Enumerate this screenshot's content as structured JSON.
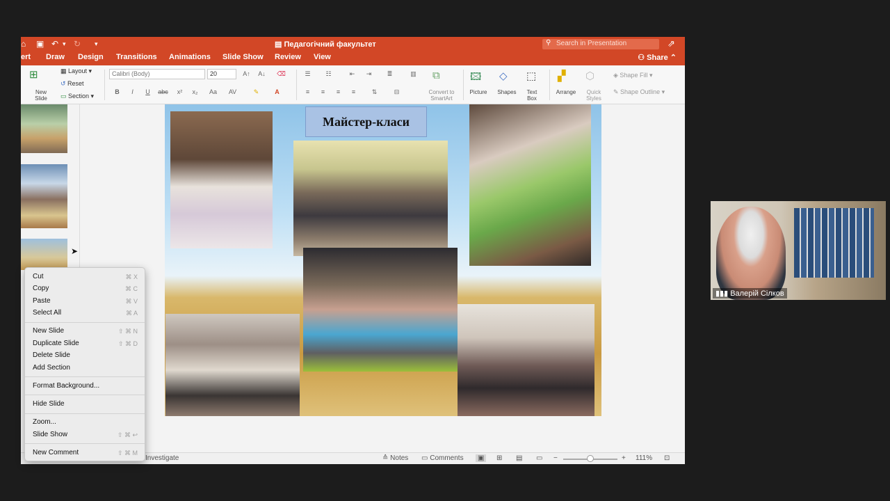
{
  "window": {
    "title": "Педагогічний факультет",
    "search_placeholder": "Search in Presentation",
    "share_label": "Share"
  },
  "tabs": [
    "ert",
    "Draw",
    "Design",
    "Transitions",
    "Animations",
    "Slide Show",
    "Review",
    "View"
  ],
  "ribbon": {
    "new_slide": "New Slide",
    "layout": "Layout",
    "reset": "Reset",
    "section": "Section",
    "font_name": "Calibri (Body)",
    "font_size": "20",
    "convert_smartart": "Convert to SmartArt",
    "picture": "Picture",
    "shapes": "Shapes",
    "text_box": "Text Box",
    "arrange": "Arrange",
    "quick_styles": "Quick Styles",
    "shape_fill": "Shape Fill",
    "shape_outline": "Shape Outline"
  },
  "slide": {
    "title": "Майстер-класи"
  },
  "context_menu": {
    "items": [
      {
        "label": "Cut",
        "shortcut": "⌘ X"
      },
      {
        "label": "Copy",
        "shortcut": "⌘ C"
      },
      {
        "label": "Paste",
        "shortcut": "⌘ V"
      },
      {
        "label": "Select All",
        "shortcut": "⌘ A"
      },
      {
        "label": "New Slide",
        "shortcut": "⇧ ⌘ N"
      },
      {
        "label": "Duplicate Slide",
        "shortcut": "⇧ ⌘ D"
      },
      {
        "label": "Delete Slide",
        "shortcut": ""
      },
      {
        "label": "Add Section",
        "shortcut": ""
      },
      {
        "label": "Format Background...",
        "shortcut": ""
      },
      {
        "label": "Hide Slide",
        "shortcut": ""
      },
      {
        "label": "Zoom...",
        "shortcut": ""
      },
      {
        "label": "Slide Show",
        "shortcut": "⇧ ⌘ ↩"
      },
      {
        "label": "New Comment",
        "shortcut": "⇧ ⌘ M"
      }
    ]
  },
  "status": {
    "investigate": "Investigate",
    "notes": "Notes",
    "comments": "Comments",
    "zoom": "111%"
  },
  "video": {
    "participant_name": "Валерій Сілков"
  },
  "colors": {
    "accent": "#d24726",
    "slide_sky": "#8fc3e8",
    "slide_field": "#c99a42",
    "title_box": "#a9c2e4"
  }
}
